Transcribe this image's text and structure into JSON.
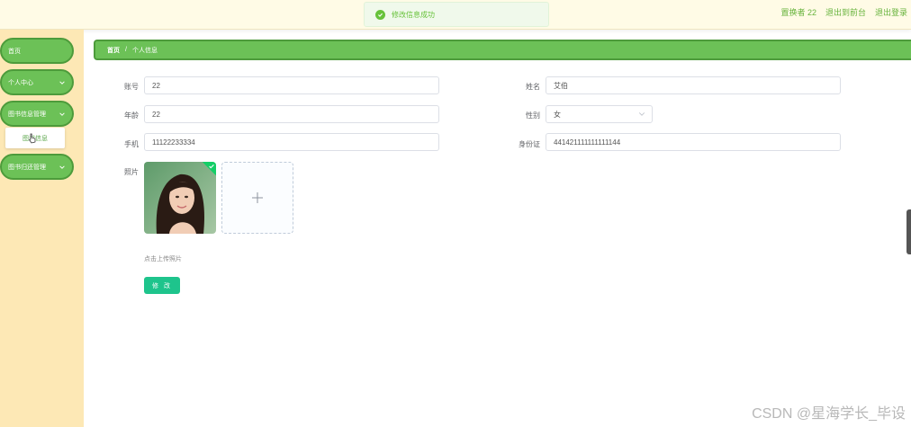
{
  "toast": {
    "message": "修改信息成功"
  },
  "header": {
    "user_label": "置换者 22",
    "back_to_front": "退出到前台",
    "logout": "退出登录"
  },
  "sidebar": {
    "items": [
      {
        "label": "首页"
      },
      {
        "label": "个人中心"
      },
      {
        "label": "图书信息管理"
      },
      {
        "label": "图书归还管理"
      }
    ],
    "submenu": {
      "label": "图书信息"
    }
  },
  "breadcrumb": {
    "home": "首页",
    "separator": "/",
    "current": "个人信息"
  },
  "form": {
    "account_label": "账号",
    "account_value": "22",
    "name_label": "姓名",
    "name_value": "艾伯",
    "age_label": "年龄",
    "age_value": "22",
    "gender_label": "性别",
    "gender_value": "女",
    "phone_label": "手机",
    "phone_value": "11122233334",
    "idcard_label": "身份证",
    "idcard_value": "441421111111111144",
    "photo_label": "照片",
    "upload_tip": "点击上传照片",
    "submit_label": "修 改"
  },
  "watermark": "CSDN @星海学长_毕设",
  "colors": {
    "menu_green": "#6cc157",
    "menu_border": "#4d9b3b",
    "sidebar_bg": "#fde8b5",
    "topbar_bg": "#fffbe6",
    "button_green": "#1ec48c",
    "success_green": "#67c23a"
  },
  "icons": [
    "check-circle-icon",
    "chevron-down-icon",
    "plus-icon",
    "pointer-cursor-icon",
    "check-badge-icon"
  ]
}
